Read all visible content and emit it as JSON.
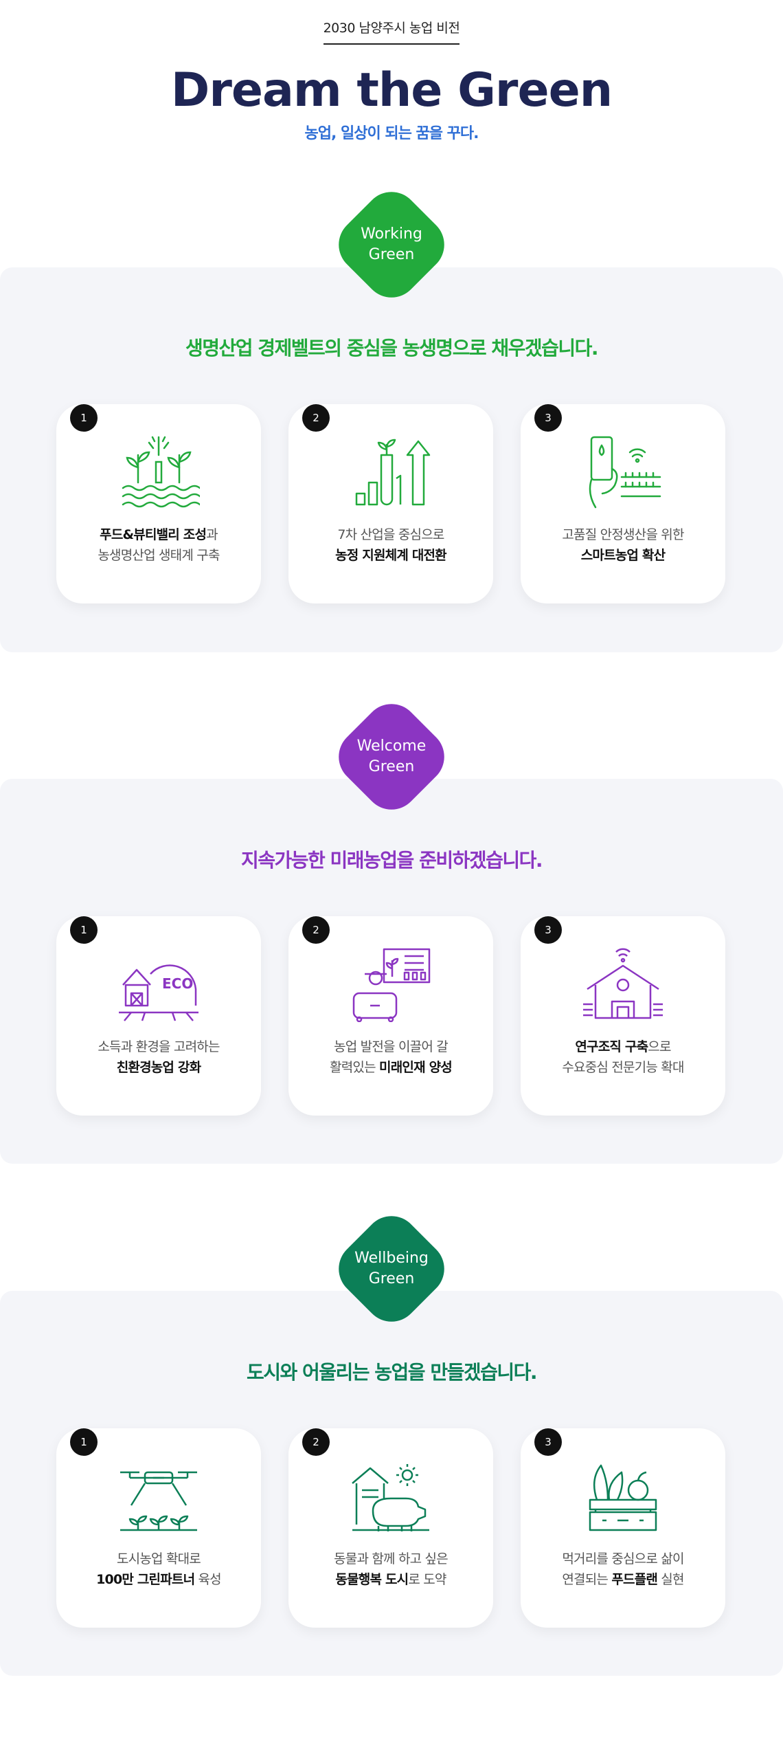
{
  "header": {
    "eyebrow": "2030 남양주시 농업 비전",
    "title": "Dream the Green",
    "subtitle": "농업, 일상이 되는 꿈을 꾸다."
  },
  "sections": [
    {
      "badge": "Working\nGreen",
      "color": "#22aa3c",
      "headline": "생명산업 경제벨트의 중심을 농생명으로 채우겠습니다.",
      "cards": [
        {
          "num": "1",
          "icon": "sprout-irrigation-icon",
          "line1_bold": "푸드&뷰티밸리 조성",
          "line1_rest": "과",
          "line2_pre": "농생명산업 생태계 구축",
          "line2_bold": "",
          "line2_post": ""
        },
        {
          "num": "2",
          "icon": "growth-chart-icon",
          "line1_bold": "",
          "line1_rest": "7차 산업을 중심으로",
          "line2_pre": "",
          "line2_bold": "농정 지원체계 대전환",
          "line2_post": ""
        },
        {
          "num": "3",
          "icon": "smart-farm-icon",
          "line1_bold": "",
          "line1_rest": "고품질 안정생산을 위한",
          "line2_pre": "",
          "line2_bold": "스마트농업 확산",
          "line2_post": ""
        }
      ]
    },
    {
      "badge": "Welcome\nGreen",
      "color": "#8b35c2",
      "headline": "지속가능한 미래농업을 준비하겠습니다.",
      "cards": [
        {
          "num": "1",
          "icon": "eco-barn-icon",
          "line1_bold": "",
          "line1_rest": "소득과 환경을 고려하는",
          "line2_pre": "",
          "line2_bold": "친환경농업 강화",
          "line2_post": ""
        },
        {
          "num": "2",
          "icon": "farmer-training-icon",
          "line1_bold": "",
          "line1_rest": "농업 발전을 이끌어 갈",
          "line2_pre": "활력있는 ",
          "line2_bold": "미래인재 양성",
          "line2_post": ""
        },
        {
          "num": "3",
          "icon": "research-house-icon",
          "line1_bold": "연구조직 구축",
          "line1_rest": "으로",
          "line2_pre": "수요중심 전문기능 확대",
          "line2_bold": "",
          "line2_post": ""
        }
      ]
    },
    {
      "badge": "Wellbeing\nGreen",
      "color": "#0c7f57",
      "headline": "도시와 어울리는 농업을 만들겠습니다.",
      "cards": [
        {
          "num": "1",
          "icon": "drone-seedling-icon",
          "line1_bold": "",
          "line1_rest": "도시농업 확대로",
          "line2_pre": "",
          "line2_bold": "100만 그린파트너",
          "line2_post": " 육성"
        },
        {
          "num": "2",
          "icon": "animal-welfare-icon",
          "line1_bold": "",
          "line1_rest": "동물과 함께 하고 싶은",
          "line2_pre": "",
          "line2_bold": "동물행복 도시",
          "line2_post": "로 도약"
        },
        {
          "num": "3",
          "icon": "produce-crate-icon",
          "line1_bold": "",
          "line1_rest": "먹거리를 중심으로 삶이",
          "line2_pre": "연결되는 ",
          "line2_bold": "푸드플랜",
          "line2_post": " 실현"
        }
      ]
    }
  ]
}
